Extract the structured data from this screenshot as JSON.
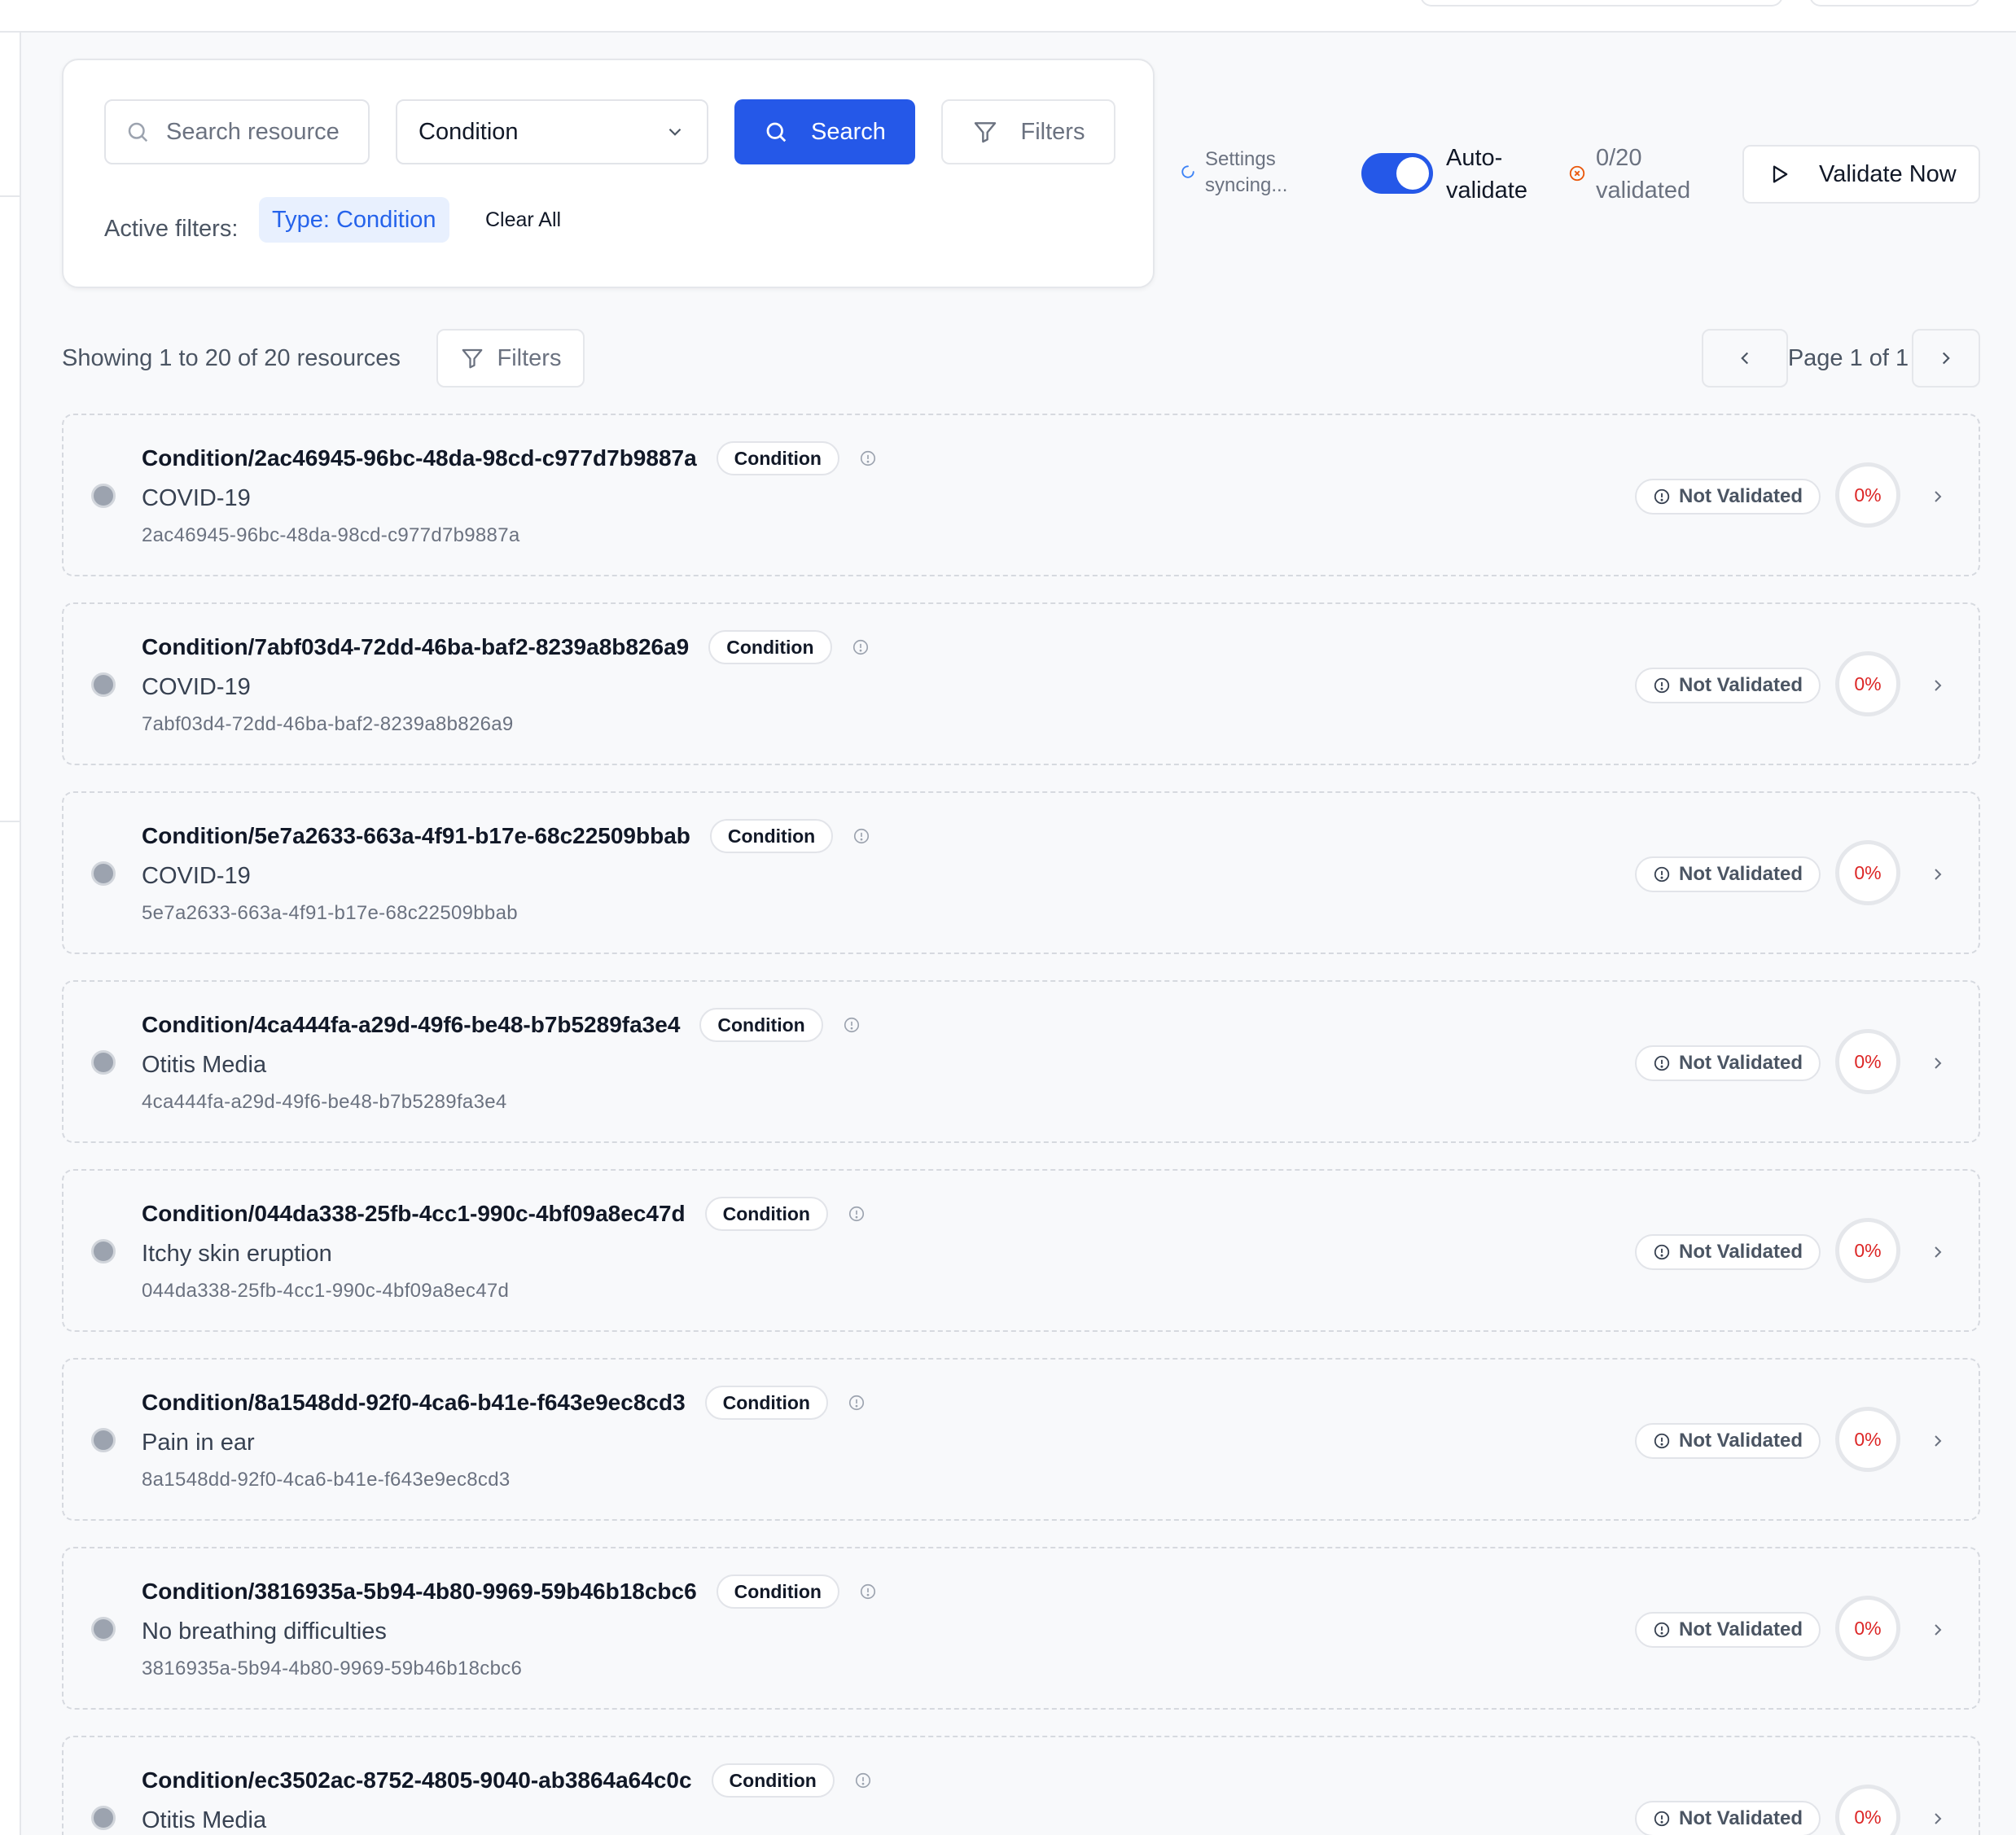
{
  "search": {
    "placeholder": "Search resource",
    "type_select": "Condition",
    "search_button": "Search",
    "filters_button": "Filters",
    "active_filters_label": "Active filters:",
    "active_filter_chip": "Type: Condition",
    "clear_all": "Clear All"
  },
  "controls": {
    "sync_status": "Settings syncing...",
    "auto_validate_label": "Auto-validate",
    "auto_validate_on": true,
    "validated_count": "0/20 validated",
    "validate_now_button": "Validate Now"
  },
  "results": {
    "showing": "Showing 1 to 20 of 20 resources",
    "filters_button": "Filters",
    "page_indicator": "Page 1 of 1"
  },
  "colors": {
    "accent": "#2558e8",
    "status_red": "#dc2626",
    "warning_orange": "#ea580c"
  },
  "resources": [
    {
      "id": "Condition/2ac46945-96bc-48da-98cd-c977d7b9887a",
      "type": "Condition",
      "display": "COVID-19",
      "uuid": "2ac46945-96bc-48da-98cd-c977d7b9887a",
      "status": "Not Validated",
      "score": "0%"
    },
    {
      "id": "Condition/7abf03d4-72dd-46ba-baf2-8239a8b826a9",
      "type": "Condition",
      "display": "COVID-19",
      "uuid": "7abf03d4-72dd-46ba-baf2-8239a8b826a9",
      "status": "Not Validated",
      "score": "0%"
    },
    {
      "id": "Condition/5e7a2633-663a-4f91-b17e-68c22509bbab",
      "type": "Condition",
      "display": "COVID-19",
      "uuid": "5e7a2633-663a-4f91-b17e-68c22509bbab",
      "status": "Not Validated",
      "score": "0%"
    },
    {
      "id": "Condition/4ca444fa-a29d-49f6-be48-b7b5289fa3e4",
      "type": "Condition",
      "display": "Otitis Media",
      "uuid": "4ca444fa-a29d-49f6-be48-b7b5289fa3e4",
      "status": "Not Validated",
      "score": "0%"
    },
    {
      "id": "Condition/044da338-25fb-4cc1-990c-4bf09a8ec47d",
      "type": "Condition",
      "display": "Itchy skin eruption",
      "uuid": "044da338-25fb-4cc1-990c-4bf09a8ec47d",
      "status": "Not Validated",
      "score": "0%"
    },
    {
      "id": "Condition/8a1548dd-92f0-4ca6-b41e-f643e9ec8cd3",
      "type": "Condition",
      "display": "Pain in ear",
      "uuid": "8a1548dd-92f0-4ca6-b41e-f643e9ec8cd3",
      "status": "Not Validated",
      "score": "0%"
    },
    {
      "id": "Condition/3816935a-5b94-4b80-9969-59b46b18cbc6",
      "type": "Condition",
      "display": "No breathing difficulties",
      "uuid": "3816935a-5b94-4b80-9969-59b46b18cbc6",
      "status": "Not Validated",
      "score": "0%"
    },
    {
      "id": "Condition/ec3502ac-8752-4805-9040-ab3864a64c0c",
      "type": "Condition",
      "display": "Otitis Media",
      "uuid": "",
      "status": "Not Validated",
      "score": "0%"
    }
  ]
}
